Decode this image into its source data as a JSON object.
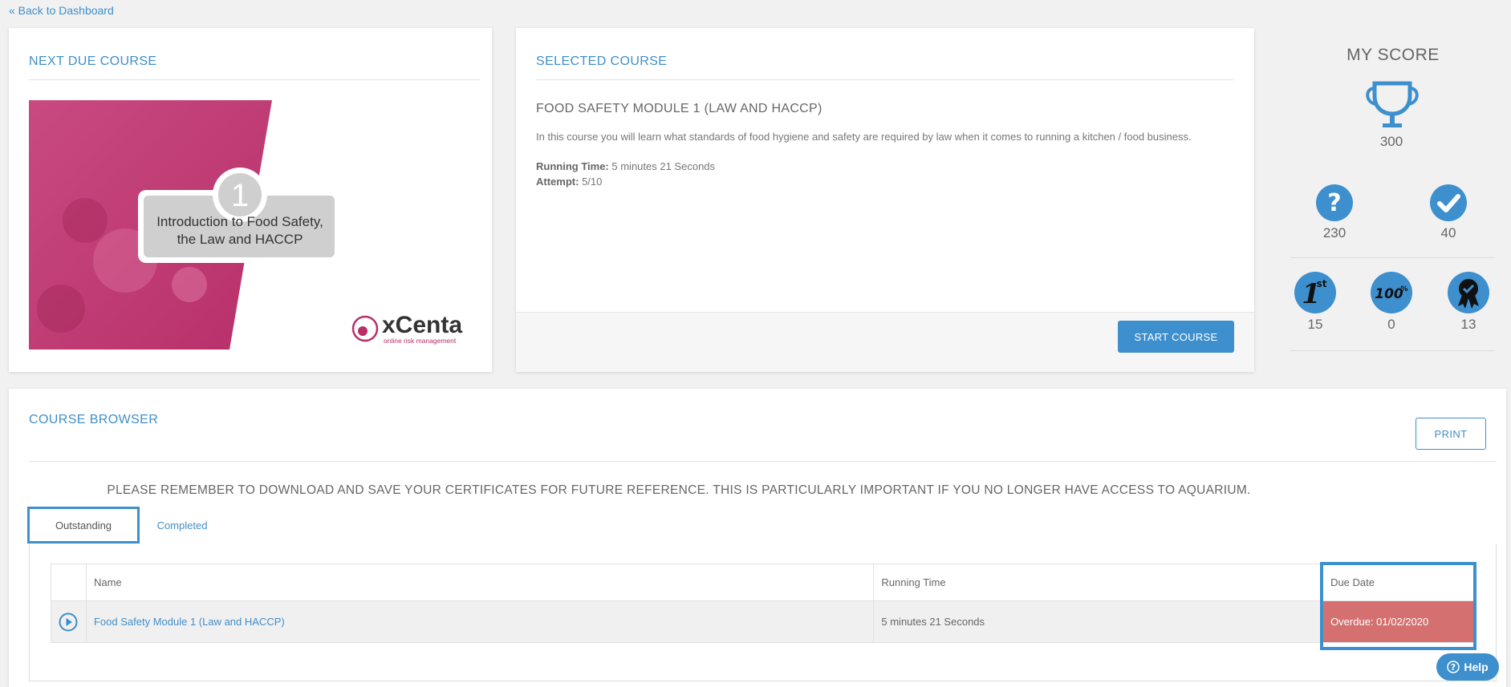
{
  "nav": {
    "back_label": "« Back to Dashboard"
  },
  "next_due": {
    "title": "NEXT DUE COURSE",
    "thumb": {
      "module_number": "1",
      "caption_line1": "Introduction to Food Safety,",
      "caption_line2": "the Law and HACCP",
      "brand_name": "xCenta",
      "brand_tagline": "online risk management"
    }
  },
  "selected": {
    "title": "SELECTED COURSE",
    "course_name": "FOOD SAFETY MODULE 1 (LAW AND HACCP)",
    "description": "In this course you will learn what standards of food hygiene and safety are required by law when it comes to running a kitchen / food business.",
    "running_time_label": "Running Time:",
    "running_time_value": "5 minutes 21 Seconds",
    "attempt_label": "Attempt:",
    "attempt_value": "5/10",
    "start_label": "START COURSE"
  },
  "score": {
    "title": "MY SCORE",
    "total": "300",
    "questions": "230",
    "correct": "40",
    "first_place": "15",
    "perfect": "0",
    "badges": "13",
    "icons": [
      "trophy-icon",
      "question-icon",
      "check-icon",
      "first-place-icon",
      "hundred-percent-icon",
      "ribbon-badge-icon"
    ],
    "first_badge_text": "1",
    "first_badge_sup": "st",
    "perfect_badge_text": "100",
    "perfect_badge_sup": "%"
  },
  "browser": {
    "title": "COURSE BROWSER",
    "print_label": "PRINT",
    "notice": "PLEASE REMEMBER TO DOWNLOAD AND SAVE YOUR CERTIFICATES FOR FUTURE REFERENCE. THIS IS PARTICULARLY IMPORTANT IF YOU NO LONGER HAVE ACCESS TO AQUARIUM.",
    "tabs": [
      {
        "label": "Outstanding",
        "active": true
      },
      {
        "label": "Completed",
        "active": false
      }
    ],
    "columns": [
      "",
      "Name",
      "Running Time",
      "Due Date"
    ],
    "rows": [
      {
        "name": "Food Safety Module 1 (Law and HACCP)",
        "running_time": "5 minutes 21 Seconds",
        "due": "Overdue: 01/02/2020"
      }
    ]
  },
  "help_label": "Help",
  "colors": {
    "accent": "#3d8fcd",
    "overdue": "#d47070",
    "brand_pink": "#c2336e"
  }
}
